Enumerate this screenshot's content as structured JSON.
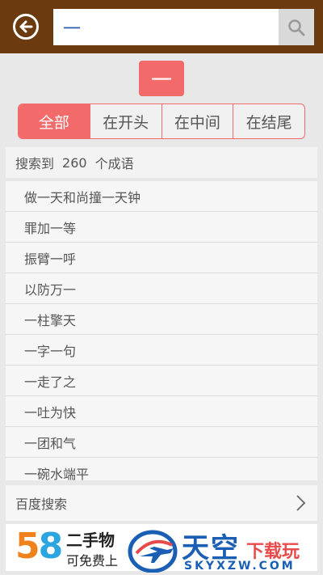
{
  "search": {
    "value": "一",
    "placeholder": ""
  },
  "selected_char": "一",
  "tabs": [
    {
      "label": "全部",
      "active": true
    },
    {
      "label": "在开头",
      "active": false
    },
    {
      "label": "在中间",
      "active": false
    },
    {
      "label": "在结尾",
      "active": false
    }
  ],
  "result": {
    "prefix": "搜索到",
    "count": "260",
    "suffix": "个成语"
  },
  "idioms": [
    "做一天和尚撞一天钟",
    "罪加一等",
    "振臂一呼",
    "以防万一",
    "一柱擎天",
    "一字一句",
    "一走了之",
    "一吐为快",
    "一团和气",
    "一碗水端平"
  ],
  "baidu_search_label": "百度搜索",
  "ad": {
    "logo_five": "5",
    "logo_eight": "8",
    "line1": "二手物",
    "line2": "可免费上"
  },
  "watermark": {
    "title": "天空",
    "subtitle": "下载玩",
    "url": "SKYXZW.COM"
  },
  "colors": {
    "header": "#6b3a0f",
    "accent": "#f26a6a",
    "brand_blue": "#1a5fb4"
  }
}
